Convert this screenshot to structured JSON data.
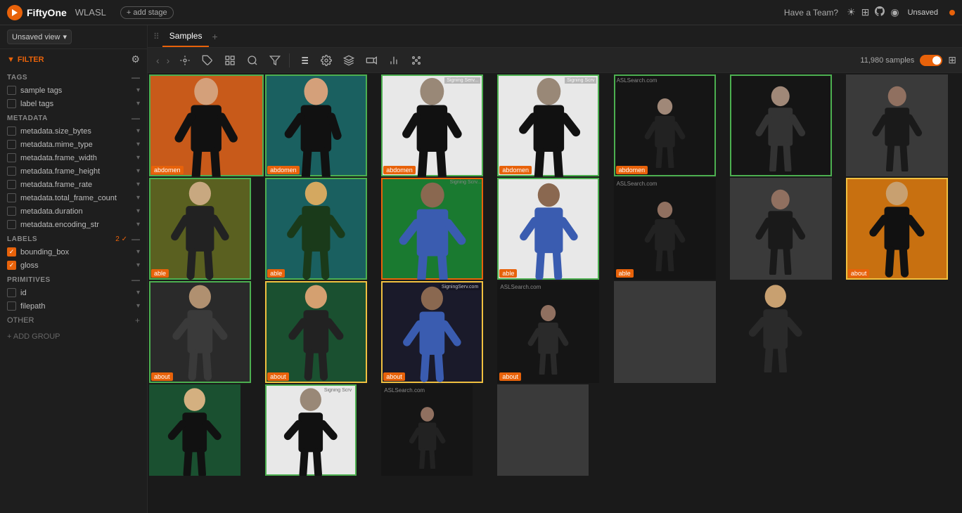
{
  "topbar": {
    "logo_text": "▶",
    "title": "FiftyOne",
    "dataset": "WLASL",
    "add_stage_label": "+ add stage",
    "have_team_label": "Have a Team?",
    "unsaved_label": "Unsaved"
  },
  "sidebar": {
    "view_label": "Unsaved view",
    "filter_label": "FILTER",
    "tags_label": "TAGS",
    "tags_minus": "—",
    "sample_tags_label": "sample tags",
    "label_tags_label": "label tags",
    "metadata_label": "METADATA",
    "metadata_minus": "—",
    "metadata_items": [
      "metadata.size_bytes",
      "metadata.mime_type",
      "metadata.frame_width",
      "metadata.frame_height",
      "metadata.frame_rate",
      "metadata.total_frame_count",
      "metadata.duration",
      "metadata.encoding_str"
    ],
    "labels_label": "LABELS",
    "labels_count": "2 ✓",
    "labels_minus": "—",
    "label_items": [
      {
        "name": "bounding_box",
        "checked": true
      },
      {
        "name": "gloss",
        "checked": true
      }
    ],
    "primitives_label": "PRIMITIVES",
    "primitives_minus": "—",
    "primitive_items": [
      "id",
      "filepath"
    ],
    "other_label": "OthER",
    "add_group_label": "+ ADD GROUP"
  },
  "toolbar": {
    "nav_back": "‹",
    "nav_forward": "›",
    "sample_count": "11,980 samples",
    "unsaved_label": "Unsaved"
  },
  "tabs": {
    "samples_label": "Samples",
    "add_tab": "+"
  },
  "grid": {
    "labels": [
      "abdomen",
      "abdomen",
      "abdomen",
      "abdomen",
      "abdomen",
      "able",
      "able",
      "able",
      "able",
      "able",
      "about",
      "about",
      "about",
      "about",
      "about",
      "",
      "",
      "",
      "",
      ""
    ]
  },
  "colors": {
    "accent": "#e8620a",
    "active_border": "#4caf50",
    "label_bg": "#e8620a",
    "label_green": "#2d8a4e"
  }
}
